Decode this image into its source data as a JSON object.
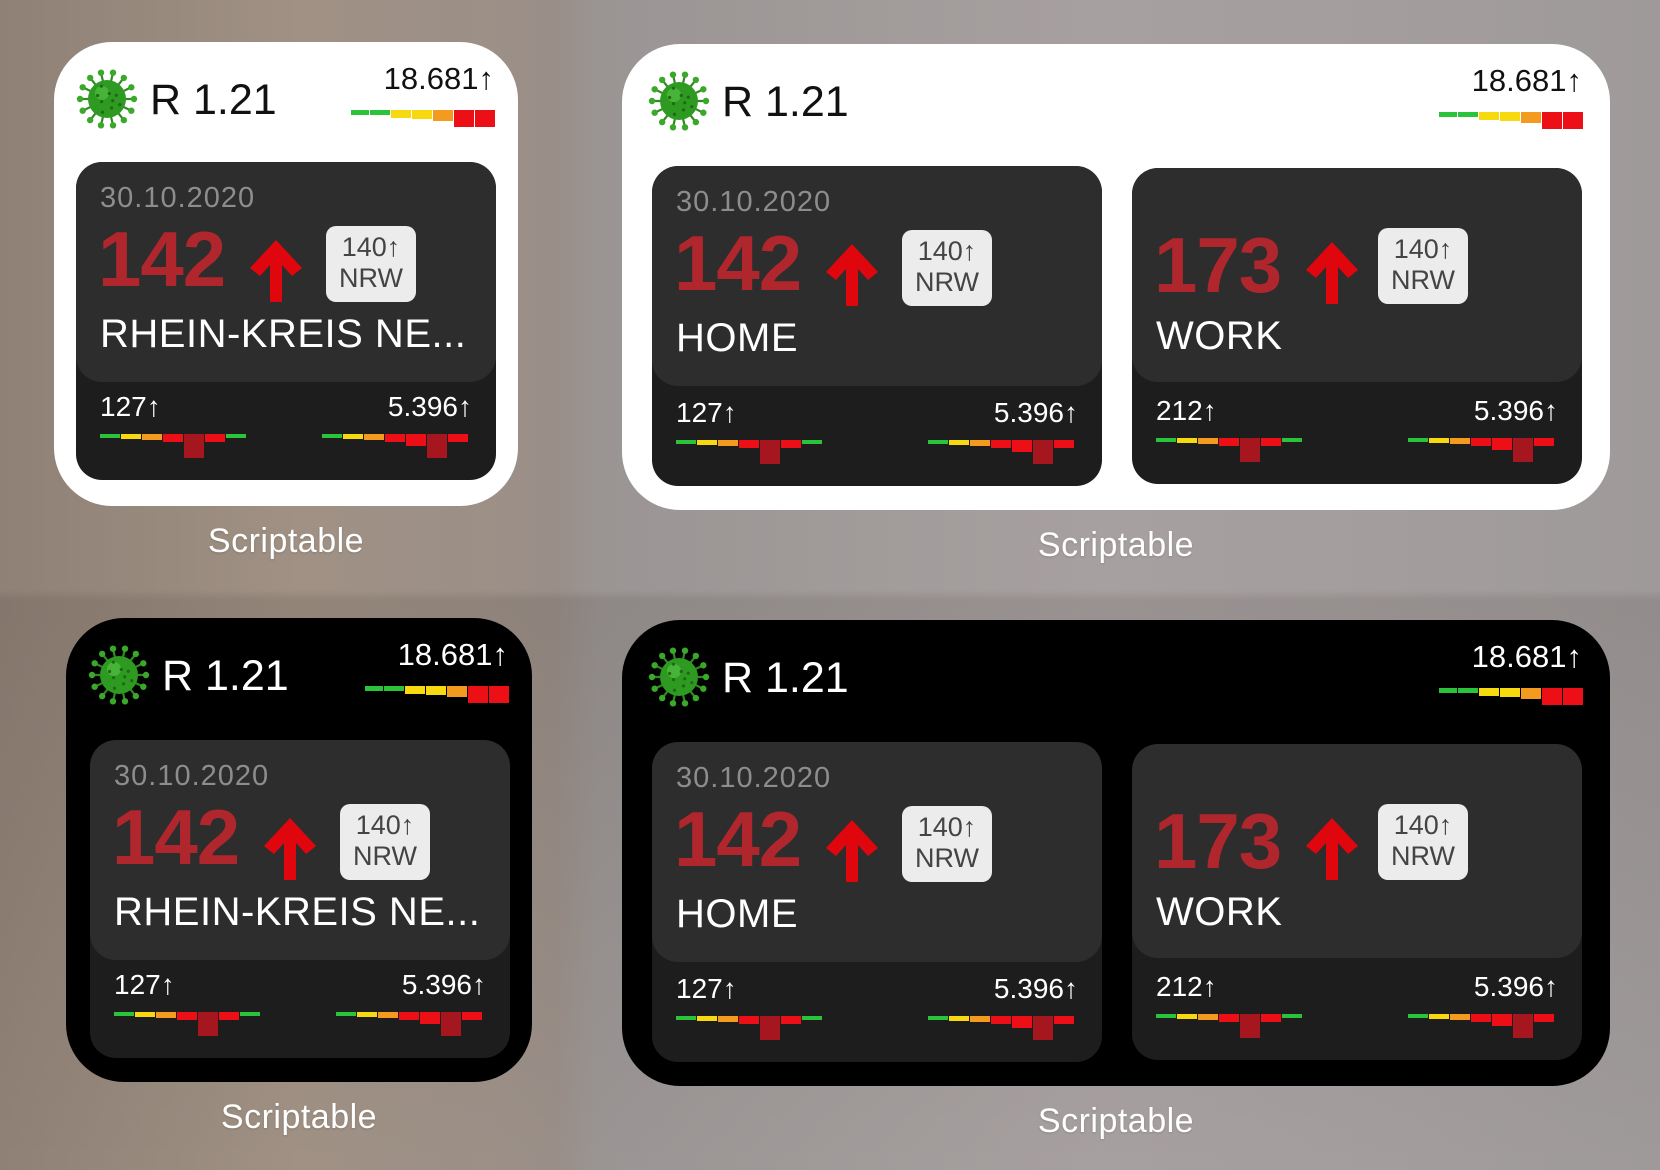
{
  "widgets": [
    {
      "theme": "light",
      "size": "small",
      "label": "Scriptable",
      "r_value": "R 1.21",
      "top_stat": "18.681↑",
      "cards": [
        {
          "date": "30.10.2020",
          "incidence": "142",
          "badge": {
            "value": "140↑",
            "region": "NRW"
          },
          "place": "RHEIN-KREIS NE...",
          "left_stat": "127↑",
          "right_stat": "5.396↑"
        }
      ]
    },
    {
      "theme": "light",
      "size": "medium",
      "label": "Scriptable",
      "r_value": "R 1.21",
      "top_stat": "18.681↑",
      "cards": [
        {
          "date": "30.10.2020",
          "incidence": "142",
          "badge": {
            "value": "140↑",
            "region": "NRW"
          },
          "place": "HOME",
          "left_stat": "127↑",
          "right_stat": "5.396↑"
        },
        {
          "date": "",
          "incidence": "173",
          "badge": {
            "value": "140↑",
            "region": "NRW"
          },
          "place": "WORK",
          "left_stat": "212↑",
          "right_stat": "5.396↑"
        }
      ]
    },
    {
      "theme": "dark",
      "size": "small",
      "label": "Scriptable",
      "r_value": "R 1.21",
      "top_stat": "18.681↑",
      "cards": [
        {
          "date": "30.10.2020",
          "incidence": "142",
          "badge": {
            "value": "140↑",
            "region": "NRW"
          },
          "place": "RHEIN-KREIS NE...",
          "left_stat": "127↑",
          "right_stat": "5.396↑"
        }
      ]
    },
    {
      "theme": "dark",
      "size": "medium",
      "label": "Scriptable",
      "r_value": "R 1.21",
      "top_stat": "18.681↑",
      "cards": [
        {
          "date": "30.10.2020",
          "incidence": "142",
          "badge": {
            "value": "140↑",
            "region": "NRW"
          },
          "place": "HOME",
          "left_stat": "127↑",
          "right_stat": "5.396↑"
        },
        {
          "date": "",
          "incidence": "173",
          "badge": {
            "value": "140↑",
            "region": "NRW"
          },
          "place": "WORK",
          "left_stat": "212↑",
          "right_stat": "5.396↑"
        }
      ]
    }
  ],
  "colors": {
    "incidence_red": "#b0262d",
    "arrow_red": "#e0060e",
    "card_top": "#2d2d2d",
    "card_bottom": "#1d1d1d",
    "bar_green": "#2ac33a",
    "bar_yellow": "#f6d90f",
    "bar_orange": "#f39a1f",
    "bar_red": "#ec0f16",
    "bar_darkred": "#a6161e"
  },
  "icons": {
    "virus": "coronavirus-icon",
    "trend": "up-arrow-icon"
  }
}
